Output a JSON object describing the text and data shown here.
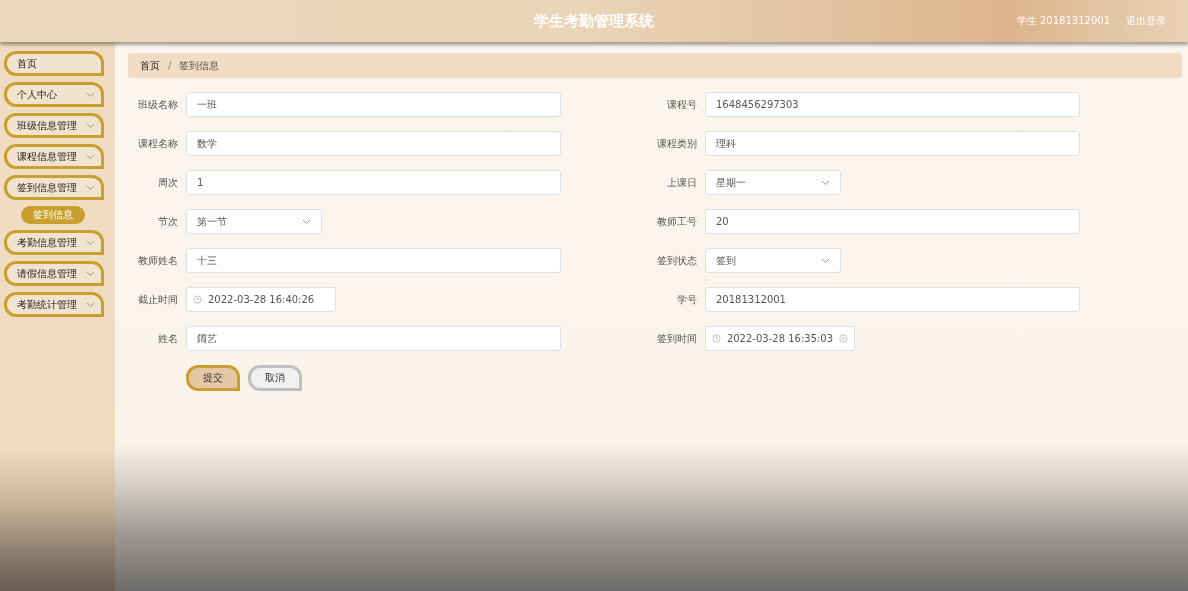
{
  "header": {
    "title": "学生考勤管理系统",
    "user": "学生 20181312001",
    "logout": "退出登录"
  },
  "sidebar": {
    "items": [
      {
        "label": "首页",
        "expandable": false
      },
      {
        "label": "个人中心",
        "expandable": true
      },
      {
        "label": "班级信息管理",
        "expandable": true
      },
      {
        "label": "课程信息管理",
        "expandable": true
      },
      {
        "label": "签到信息管理",
        "expandable": true,
        "children": [
          {
            "label": "签到信息",
            "selected": true
          }
        ]
      },
      {
        "label": "考勤信息管理",
        "expandable": true
      },
      {
        "label": "请假信息管理",
        "expandable": true
      },
      {
        "label": "考勤统计管理",
        "expandable": true
      }
    ]
  },
  "breadcrumb": {
    "separator": "/",
    "items": [
      "首页",
      "签到信息"
    ]
  },
  "form": {
    "fields": [
      {
        "label": "班级名称",
        "kind": "text",
        "value": "一班"
      },
      {
        "label": "课程号",
        "kind": "text",
        "value": "1648456297303"
      },
      {
        "label": "课程名称",
        "kind": "text",
        "value": "数学"
      },
      {
        "label": "课程类别",
        "kind": "text",
        "value": "理科"
      },
      {
        "label": "周次",
        "kind": "text",
        "value": "1"
      },
      {
        "label": "上课日",
        "kind": "select",
        "value": "星期一"
      },
      {
        "label": "节次",
        "kind": "select",
        "value": "第一节"
      },
      {
        "label": "教师工号",
        "kind": "text",
        "value": "20"
      },
      {
        "label": "教师姓名",
        "kind": "text",
        "value": "十三"
      },
      {
        "label": "签到状态",
        "kind": "select",
        "value": "签到"
      },
      {
        "label": "截止时间",
        "kind": "date",
        "value": "2022-03-28 16:40:26",
        "clearable": false
      },
      {
        "label": "学号",
        "kind": "text",
        "value": "20181312001"
      },
      {
        "label": "姓名",
        "kind": "text",
        "value": "阔艺"
      },
      {
        "label": "签到时间",
        "kind": "date",
        "value": "2022-03-28 16:35:03",
        "clearable": true
      }
    ],
    "buttons": [
      {
        "label": "提交",
        "kind": "primary"
      },
      {
        "label": "取消",
        "kind": "default"
      }
    ]
  }
}
